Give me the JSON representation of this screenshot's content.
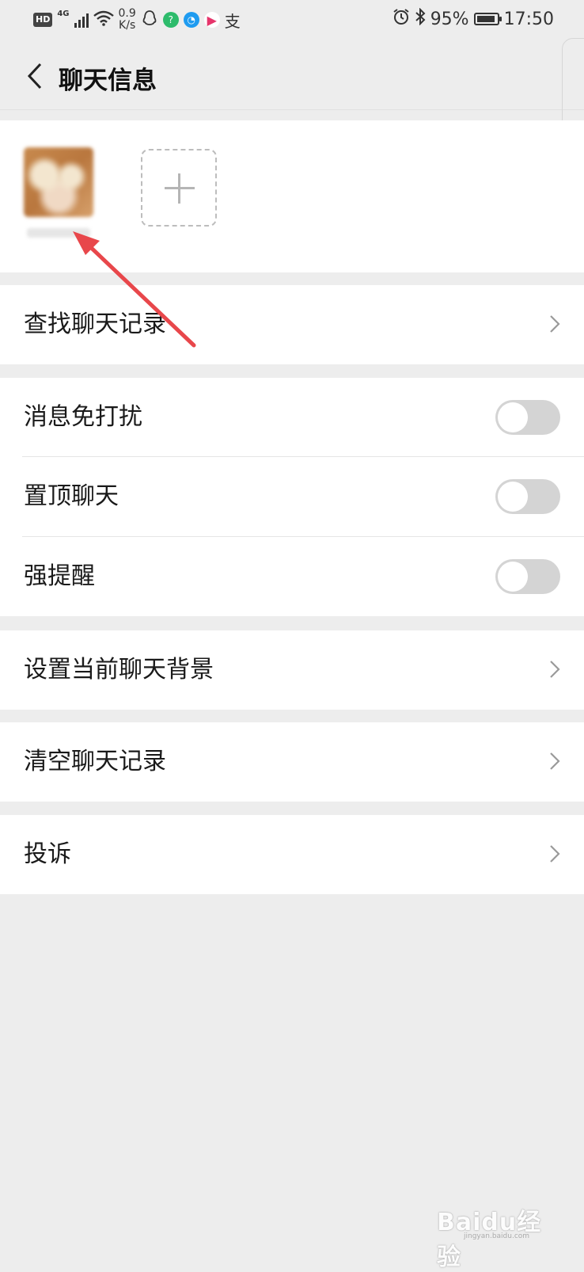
{
  "status_bar": {
    "hd": "HD",
    "network": "4G",
    "speed_value": "0.9",
    "speed_unit": "K/s",
    "app_icons": [
      "qq-icon",
      "help-app-icon",
      "browser-app-icon",
      "video-app-icon",
      "alipay-icon"
    ],
    "alipay_glyph": "支",
    "battery": "95%",
    "battery_level": 0.95,
    "time": "17:50"
  },
  "header": {
    "title": "聊天信息"
  },
  "menu": {
    "search_history": "查找聊天记录",
    "mute": "消息免打扰",
    "sticky": "置顶聊天",
    "strong_remind": "强提醒",
    "chat_background": "设置当前聊天背景",
    "clear_history": "清空聊天记录",
    "complain": "投诉"
  },
  "toggles": {
    "mute": false,
    "sticky": false,
    "strong_remind": false
  },
  "watermark": {
    "text": "Baidu经验",
    "sub": "jingyan.baidu.com"
  },
  "colors": {
    "background": "#ededed",
    "annotation_arrow": "#e8474b",
    "toggle_off": "#d4d4d4"
  }
}
